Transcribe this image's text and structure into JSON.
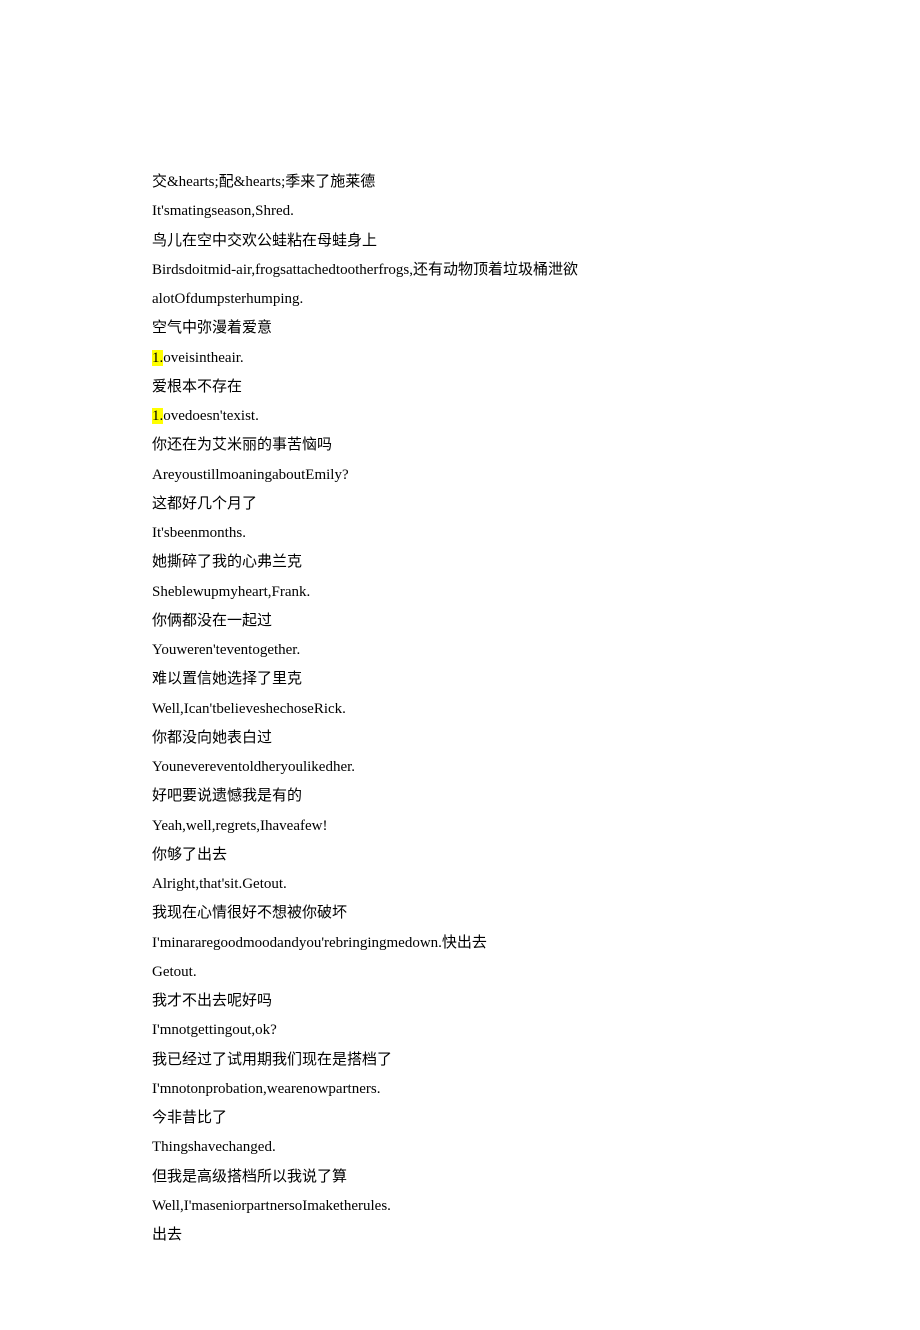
{
  "lines": [
    {
      "segments": [
        {
          "text": "交&hearts;配&hearts;季来了施莱德"
        }
      ]
    },
    {
      "segments": [
        {
          "text": "It"
        },
        {
          "text": "'"
        },
        {
          "text": "smatingseason,Shred."
        }
      ]
    },
    {
      "segments": [
        {
          "text": "鸟儿在空中交欢公蛙粘在母蛙身上"
        }
      ]
    },
    {
      "segments": [
        {
          "text": "Birdsdoitmid-air,frogsattachedtootherfrogs,还有动物顶着垃圾桶泄欲"
        }
      ]
    },
    {
      "segments": [
        {
          "text": "alotOfdumpsterhumping."
        }
      ]
    },
    {
      "segments": [
        {
          "text": "空气中弥漫着爱意"
        }
      ]
    },
    {
      "segments": [
        {
          "text": "1.",
          "highlight": true
        },
        {
          "text": "oveisintheair."
        }
      ]
    },
    {
      "segments": [
        {
          "text": "爱根本不存在"
        }
      ]
    },
    {
      "segments": [
        {
          "text": "1.",
          "highlight": true
        },
        {
          "text": "ovedoesn'texist."
        }
      ]
    },
    {
      "segments": [
        {
          "text": "你还在为艾米丽的事苦恼吗"
        }
      ]
    },
    {
      "segments": [
        {
          "text": "AreyoustillmoaningaboutEmily?"
        }
      ]
    },
    {
      "segments": [
        {
          "text": "这都好几个月了"
        }
      ]
    },
    {
      "segments": [
        {
          "text": "It'sbeenmonths."
        }
      ]
    },
    {
      "segments": [
        {
          "text": "她撕碎了我的心弗兰克"
        }
      ]
    },
    {
      "segments": [
        {
          "text": "Sheblewupmyheart,Frank."
        }
      ]
    },
    {
      "segments": [
        {
          "text": "你俩都没在一起过"
        }
      ]
    },
    {
      "segments": [
        {
          "text": "Youweren'teventogether."
        }
      ]
    },
    {
      "segments": [
        {
          "text": "难以置信她选择了里克"
        }
      ]
    },
    {
      "segments": [
        {
          "text": "Well,Ican"
        },
        {
          "text": "'"
        },
        {
          "text": "tbelieveshechoseRick."
        }
      ]
    },
    {
      "segments": [
        {
          "text": "你都没向她表白过"
        }
      ]
    },
    {
      "segments": [
        {
          "text": "Younevereventoldheryoulikedher."
        }
      ]
    },
    {
      "segments": [
        {
          "text": "好吧要说遗憾我是有的"
        }
      ]
    },
    {
      "segments": [
        {
          "text": "Yeah,well,regrets,Ihaveafew!"
        }
      ]
    },
    {
      "segments": [
        {
          "text": "你够了出去"
        }
      ]
    },
    {
      "segments": [
        {
          "text": "Alright,that'sit.Getout."
        }
      ]
    },
    {
      "segments": [
        {
          "text": "我现在心情很好不想被你破坏"
        }
      ]
    },
    {
      "segments": [
        {
          "text": "I"
        },
        {
          "text": "'"
        },
        {
          "text": "minararegoodmoodandyou'rebringingmedown.快出去"
        }
      ]
    },
    {
      "segments": [
        {
          "text": "Getout."
        }
      ]
    },
    {
      "segments": [
        {
          "text": "我才不出去呢好吗"
        }
      ]
    },
    {
      "segments": [
        {
          "text": "I"
        },
        {
          "text": "'"
        },
        {
          "text": "mnotgettingout,ok?"
        }
      ]
    },
    {
      "segments": [
        {
          "text": "我已经过了试用期我们现在是搭档了"
        }
      ]
    },
    {
      "segments": [
        {
          "text": "I"
        },
        {
          "text": "'"
        },
        {
          "text": "mnotonprobation,wearenowpartners."
        }
      ]
    },
    {
      "segments": [
        {
          "text": "今非昔比了"
        }
      ]
    },
    {
      "segments": [
        {
          "text": "Thingshavechanged."
        }
      ]
    },
    {
      "segments": [
        {
          "text": "但我是高级搭档所以我说了算"
        }
      ]
    },
    {
      "segments": [
        {
          "text": "Well,I"
        },
        {
          "text": "'"
        },
        {
          "text": "maseniorpartnersoImaketherules."
        }
      ]
    },
    {
      "segments": [
        {
          "text": "出去"
        }
      ]
    }
  ]
}
